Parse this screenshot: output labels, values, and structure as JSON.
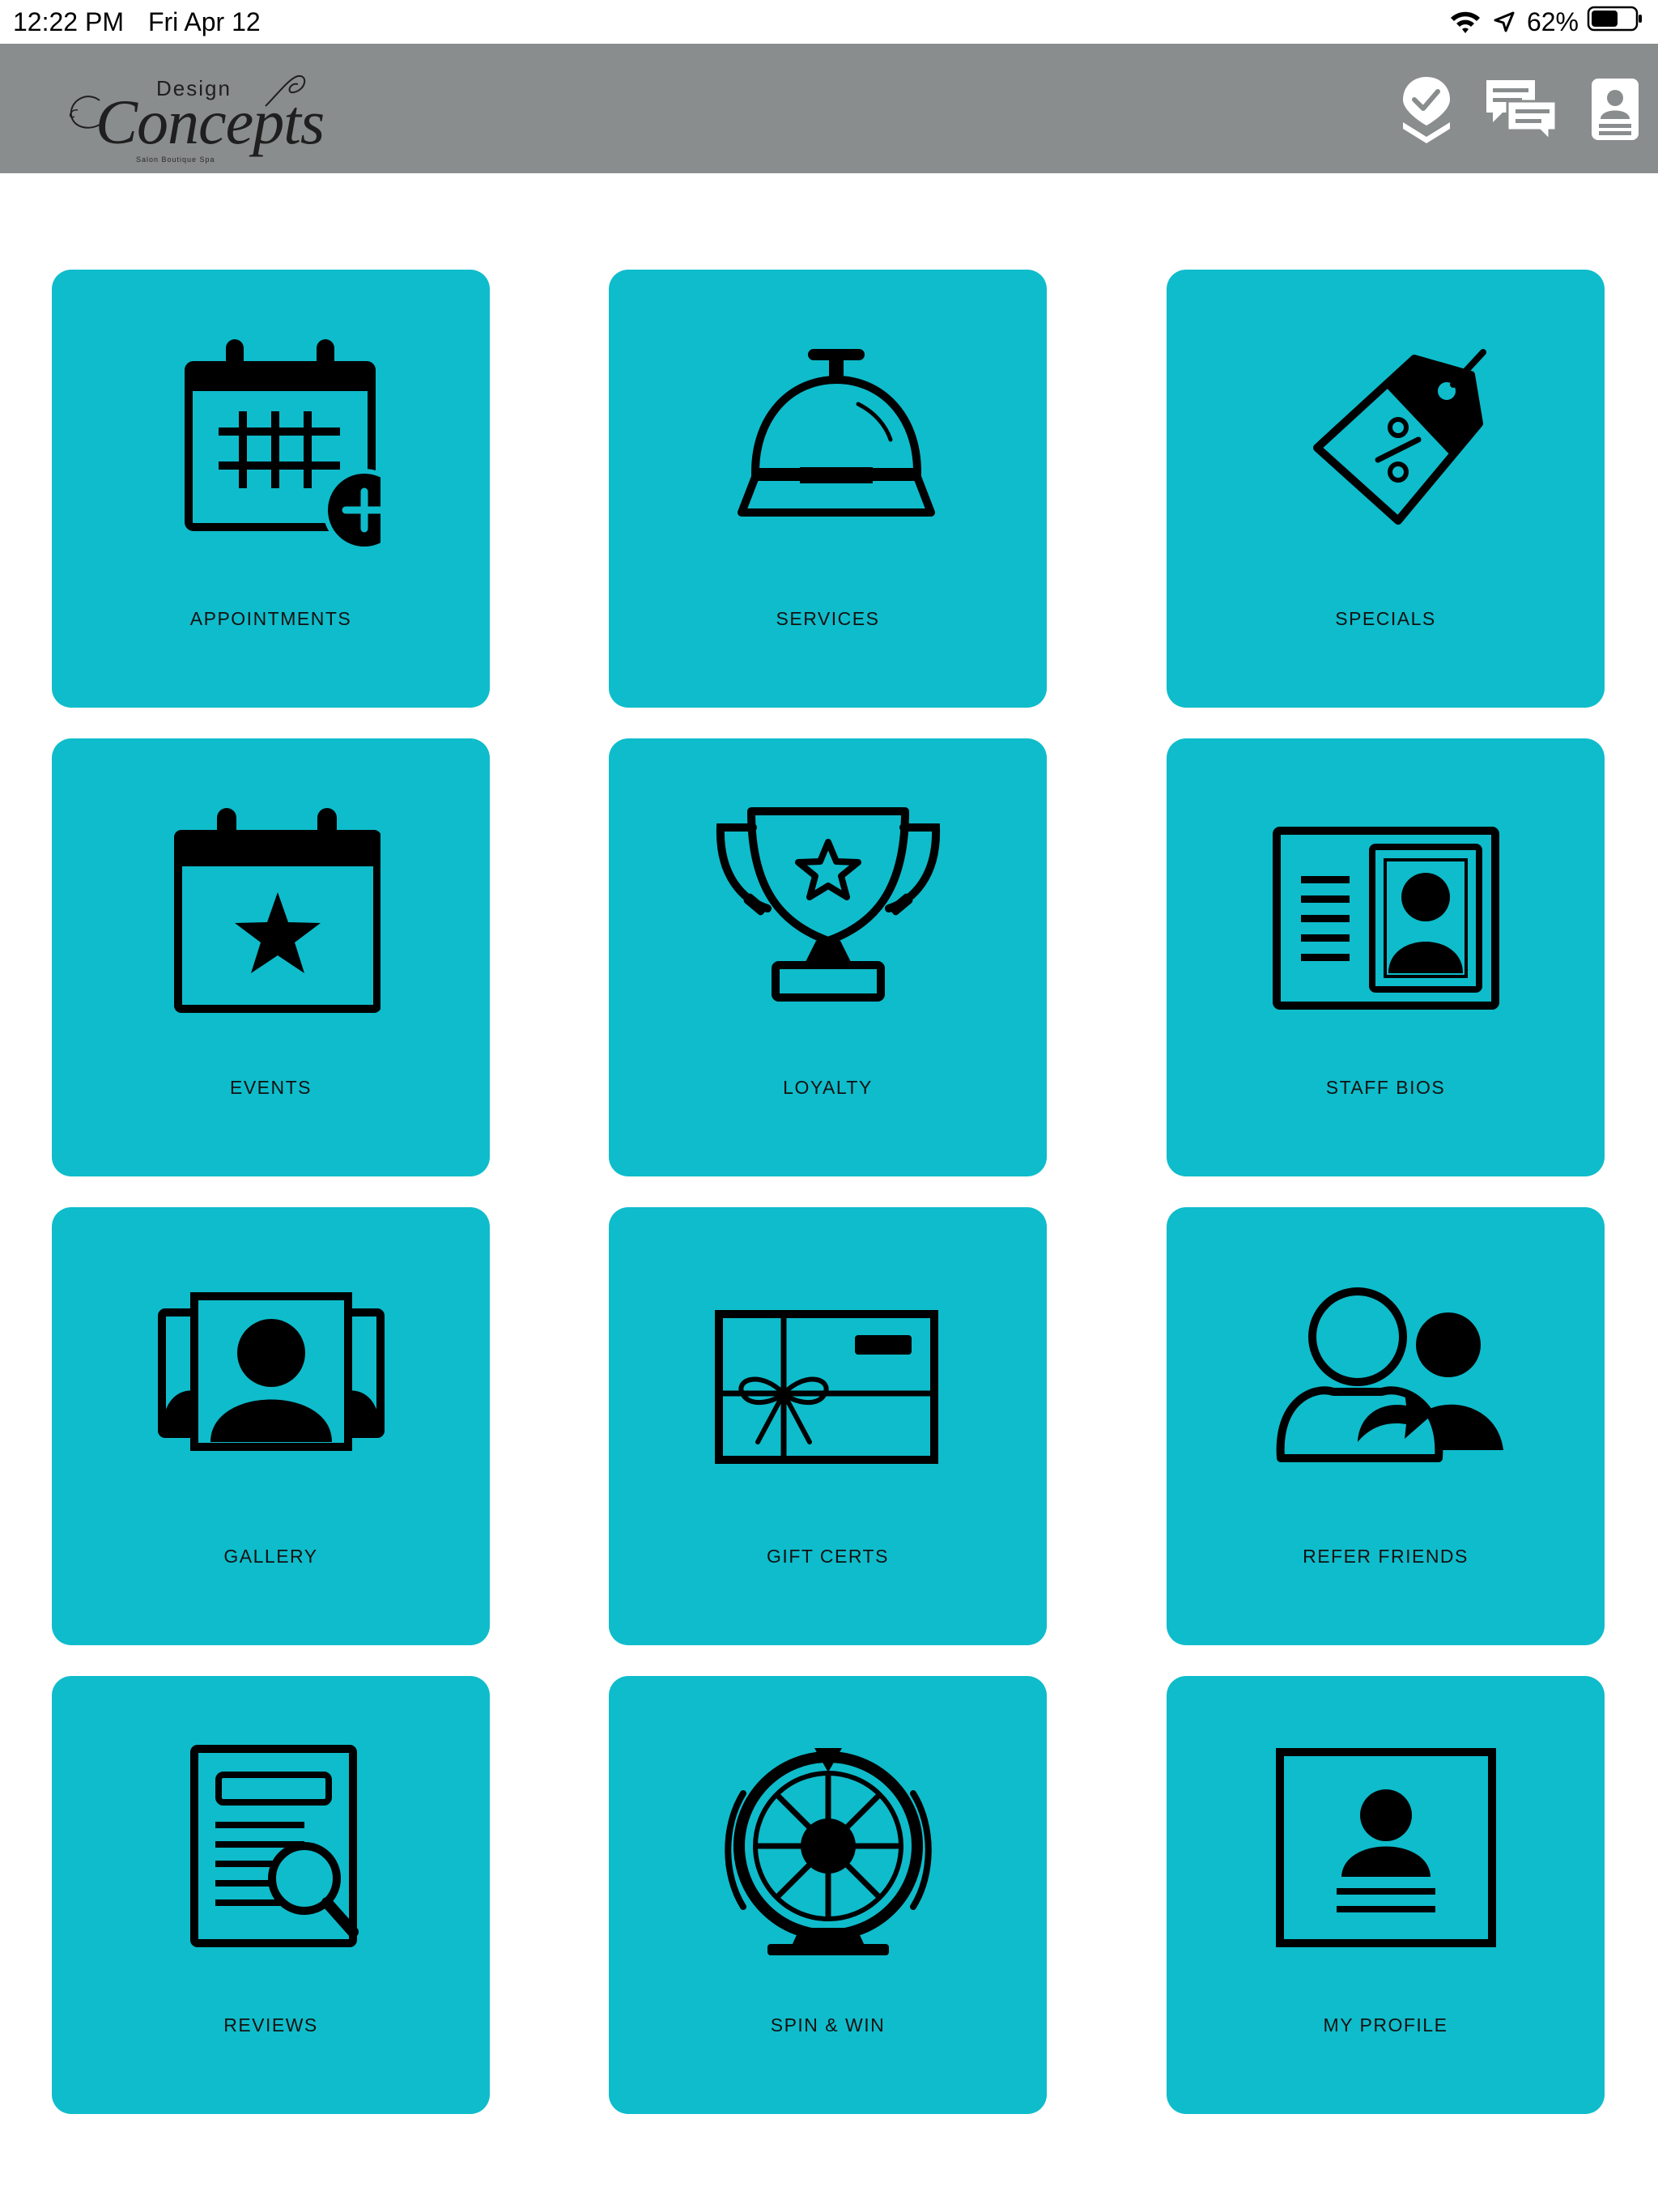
{
  "status_bar": {
    "time": "12:22 PM",
    "date": "Fri Apr 12",
    "battery_percent": "62%",
    "battery_level": 0.62,
    "icons": [
      "wifi-icon",
      "location-arrow-icon",
      "battery-icon"
    ]
  },
  "header": {
    "logo": {
      "word_top": "Design",
      "word_main": "Concepts",
      "tagline": "Salon Boutique Spa"
    },
    "actions": [
      {
        "name": "check-in-button",
        "icon": "map-pin-check-icon"
      },
      {
        "name": "messages-button",
        "icon": "chat-bubbles-icon"
      },
      {
        "name": "contact-card-button",
        "icon": "contact-card-icon"
      }
    ],
    "background": "#8a8d8d"
  },
  "tiles": [
    {
      "label": "APPOINTMENTS",
      "icon": "calendar-add-icon"
    },
    {
      "label": "SERVICES",
      "icon": "service-bell-icon"
    },
    {
      "label": "SPECIALS",
      "icon": "discount-tag-icon"
    },
    {
      "label": "EVENTS",
      "icon": "calendar-star-icon"
    },
    {
      "label": "LOYALTY",
      "icon": "trophy-star-icon"
    },
    {
      "label": "STAFF BIOS",
      "icon": "id-card-icon"
    },
    {
      "label": "GALLERY",
      "icon": "photo-gallery-icon"
    },
    {
      "label": "GIFT CERTS",
      "icon": "gift-card-icon"
    },
    {
      "label": "REFER FRIENDS",
      "icon": "refer-users-icon"
    },
    {
      "label": "REVIEWS",
      "icon": "review-document-icon"
    },
    {
      "label": "SPIN & WIN",
      "icon": "prize-wheel-icon"
    },
    {
      "label": "MY PROFILE",
      "icon": "profile-card-icon"
    }
  ],
  "colors": {
    "tile": "#0fbccb",
    "icon": "#000000",
    "header": "#8a8d8d"
  }
}
